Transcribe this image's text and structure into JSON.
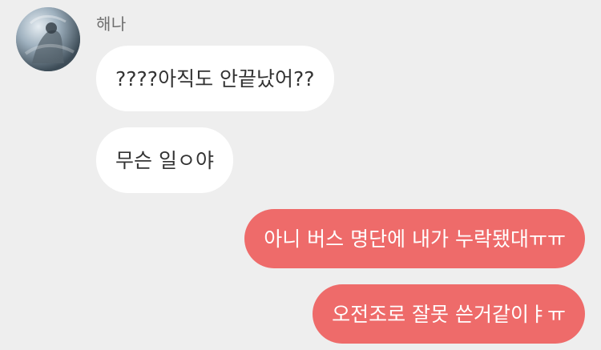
{
  "chat": {
    "sender_name": "해나",
    "messages": [
      {
        "side": "incoming",
        "text": "????아직도 안끝났어??"
      },
      {
        "side": "incoming",
        "text": "무슨 일ㅇ야"
      },
      {
        "side": "outgoing",
        "text": "아니 버스 명단에 내가 누락됐대ㅠㅠ"
      },
      {
        "side": "outgoing",
        "text": "오전조로 잘못 쓴거같이ㅑㅠ"
      }
    ]
  },
  "colors": {
    "background": "#eeeeee",
    "incoming_bubble": "#ffffff",
    "outgoing_bubble": "#ee6b6a",
    "incoming_text": "#333333",
    "outgoing_text": "#ffffff",
    "sender_name": "#6f6f6f"
  },
  "icons": {
    "avatar": "profile-photo"
  }
}
